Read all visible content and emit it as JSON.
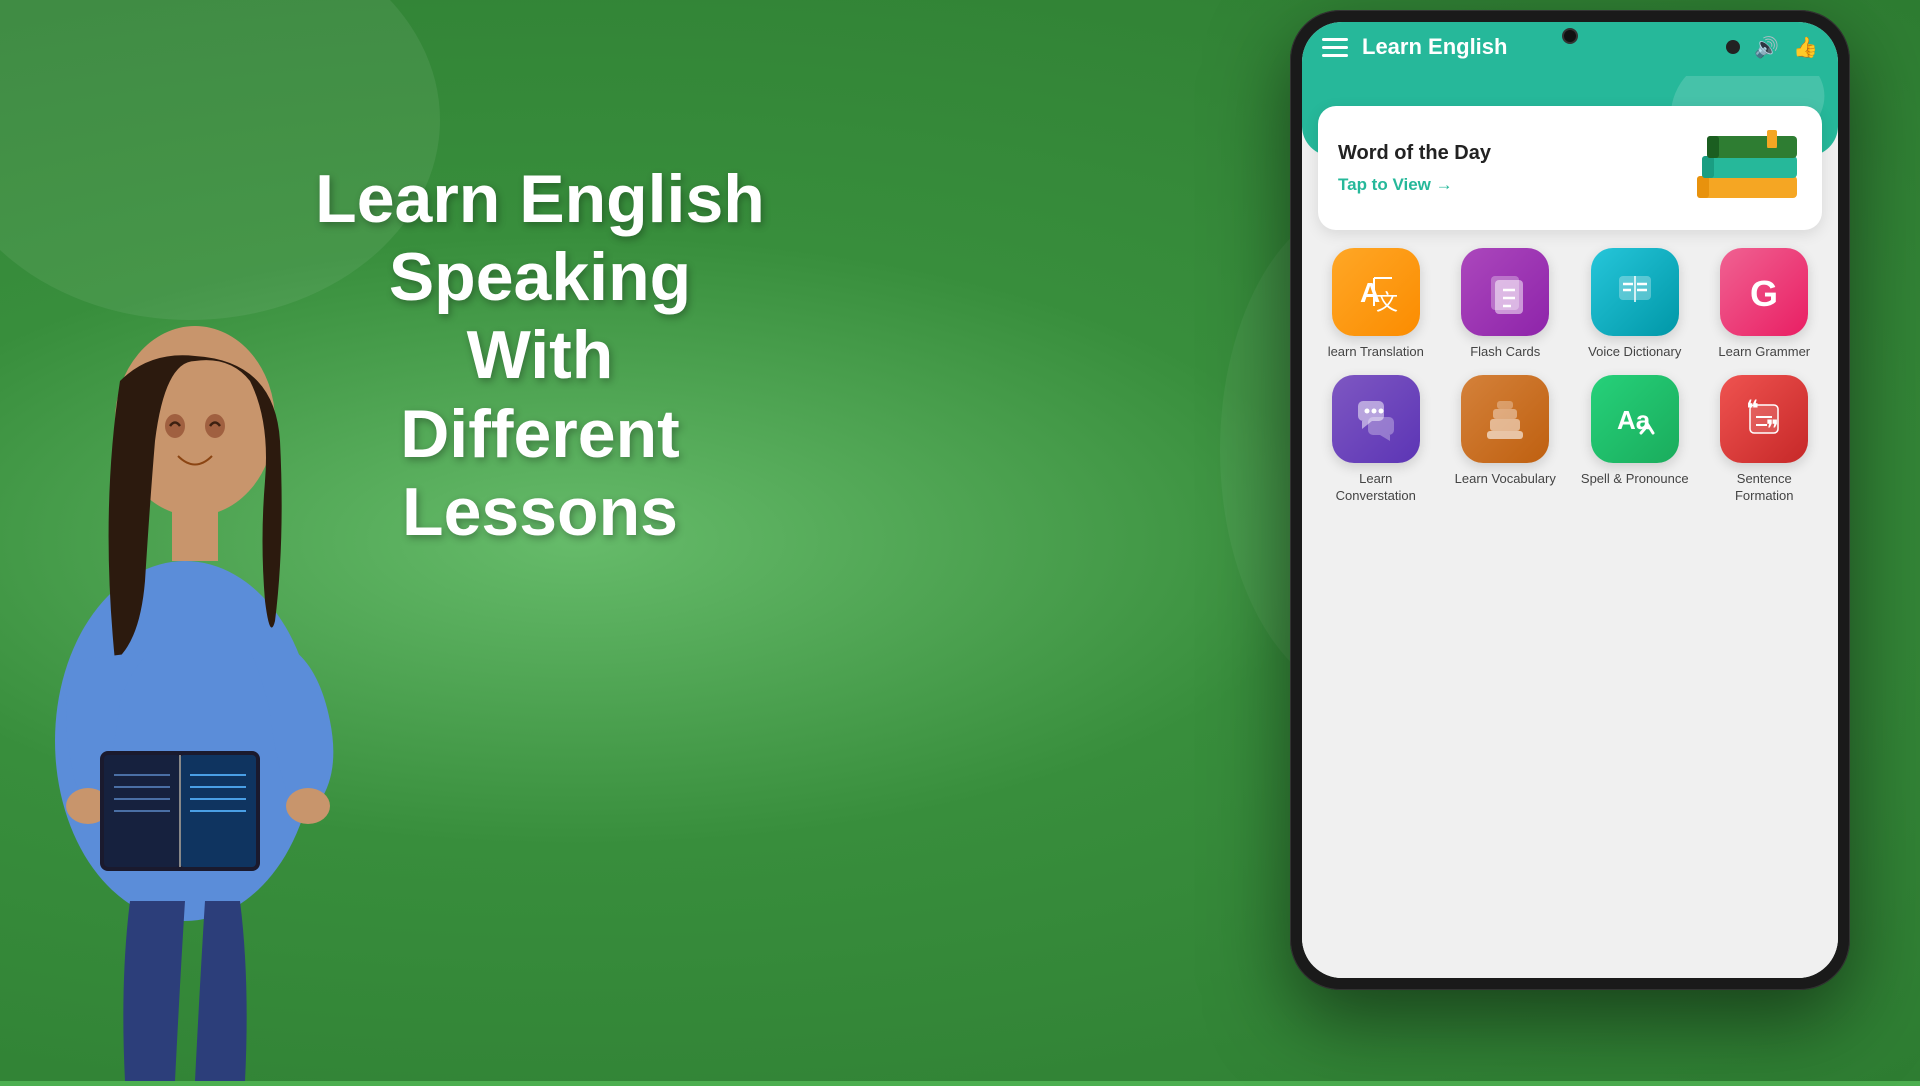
{
  "background": {
    "color_primary": "#4caf50",
    "color_dark": "#2e7d32"
  },
  "hero": {
    "title_line1": "Learn English",
    "title_line2": "Speaking",
    "title_line3": "With",
    "title_line4": "Different",
    "title_line5": "Lessons"
  },
  "app": {
    "header": {
      "title": "Learn English",
      "menu_icon": "menu-icon",
      "sound_icon": "🔊",
      "like_icon": "👍"
    },
    "word_of_day": {
      "title": "Word of the Day",
      "cta": "Tap to View →"
    },
    "features": [
      {
        "id": "learn-translation",
        "label": "learn Translation",
        "color_class": "icon-orange",
        "icon": "🔤"
      },
      {
        "id": "flash-cards",
        "label": "Flash Cards",
        "color_class": "icon-purple",
        "icon": "📋"
      },
      {
        "id": "voice-dictionary",
        "label": "Voice Dictionary",
        "color_class": "icon-teal",
        "icon": "📖"
      },
      {
        "id": "learn-grammar",
        "label": "Learn Grammer",
        "color_class": "icon-pink",
        "icon": "G"
      },
      {
        "id": "learn-conversation",
        "label": "Learn Converstation",
        "color_class": "icon-blue-purple",
        "icon": "💬"
      },
      {
        "id": "learn-vocabulary",
        "label": "Learn Vocabulary",
        "color_class": "icon-brown",
        "icon": "📚"
      },
      {
        "id": "spell-pronounce",
        "label": "Spell & Pronounce",
        "color_class": "icon-green",
        "icon": "Aa"
      },
      {
        "id": "sentence-formation",
        "label": "Sentence Formation",
        "color_class": "icon-red-pink",
        "icon": "❝❞"
      }
    ]
  }
}
